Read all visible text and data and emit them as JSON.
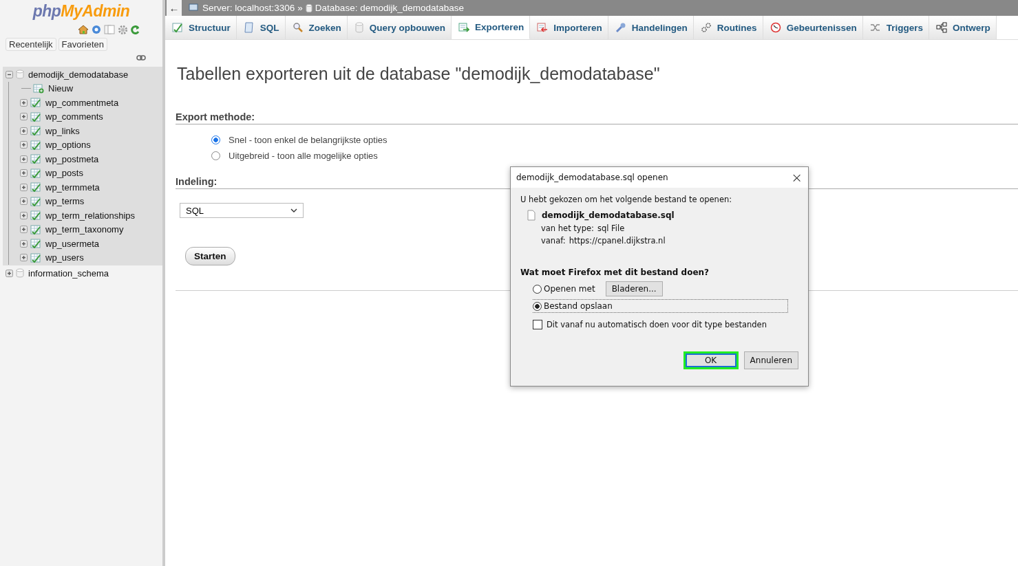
{
  "sidebar": {
    "logo": {
      "part_1": "php",
      "part_2": "MyAdmin"
    },
    "tabs": [
      {
        "label": "Recentelijk"
      },
      {
        "label": "Favorieten"
      }
    ],
    "tree": [
      {
        "label": "demodijk_demodatabase",
        "expanded": true,
        "selected": true,
        "children": [
          {
            "label": "Nieuw",
            "kind": "new"
          },
          {
            "label": "wp_commentmeta",
            "kind": "table",
            "expanded": false
          },
          {
            "label": "wp_comments",
            "kind": "table",
            "expanded": false
          },
          {
            "label": "wp_links",
            "kind": "table",
            "expanded": false
          },
          {
            "label": "wp_options",
            "kind": "table",
            "expanded": false
          },
          {
            "label": "wp_postmeta",
            "kind": "table",
            "expanded": false
          },
          {
            "label": "wp_posts",
            "kind": "table",
            "expanded": false
          },
          {
            "label": "wp_termmeta",
            "kind": "table",
            "expanded": false
          },
          {
            "label": "wp_terms",
            "kind": "table",
            "expanded": false
          },
          {
            "label": "wp_term_relationships",
            "kind": "table",
            "expanded": false
          },
          {
            "label": "wp_term_taxonomy",
            "kind": "table",
            "expanded": false
          },
          {
            "label": "wp_usermeta",
            "kind": "table",
            "expanded": false
          },
          {
            "label": "wp_users",
            "kind": "table",
            "expanded": false
          }
        ]
      },
      {
        "label": "information_schema",
        "expanded": false,
        "selected": false
      }
    ]
  },
  "breadcrumb": {
    "back": "←",
    "server": "Server: localhost:3306",
    "separator": "»",
    "database": "Database: demodijk_demodatabase"
  },
  "tabs": [
    {
      "label": "Structuur",
      "kind": "structure",
      "selected": false
    },
    {
      "label": "SQL",
      "kind": "sql",
      "selected": false
    },
    {
      "label": "Zoeken",
      "kind": "search",
      "selected": false
    },
    {
      "label": "Query opbouwen",
      "kind": "query",
      "selected": false
    },
    {
      "label": "Exporteren",
      "kind": "export",
      "selected": true
    },
    {
      "label": "Importeren",
      "kind": "import",
      "selected": false
    },
    {
      "label": "Handelingen",
      "kind": "wrench",
      "selected": false
    },
    {
      "label": "Routines",
      "kind": "gears",
      "selected": false
    },
    {
      "label": "Gebeurtenissen",
      "kind": "clock",
      "selected": false
    },
    {
      "label": "Triggers",
      "kind": "shuffle",
      "selected": false
    },
    {
      "label": "Ontwerp",
      "kind": "designer",
      "selected": false
    }
  ],
  "page": {
    "title": "Tabellen exporteren uit de database \"demodijk_demodatabase\"",
    "method": {
      "heading": "Export methode:",
      "options": [
        {
          "label": "Snel - toon enkel de belangrijkste opties",
          "selected": true
        },
        {
          "label": "Uitgebreid - toon alle mogelijke opties",
          "selected": false
        }
      ]
    },
    "format": {
      "heading": "Indeling:",
      "value": "SQL"
    },
    "submit": "Starten"
  },
  "dialog": {
    "title": "demodijk_demodatabase.sql openen",
    "close": "×",
    "intro": "U hebt gekozen om het volgende bestand te openen:",
    "filename": "demodijk_demodatabase.sql",
    "type_label": "van het type:",
    "type_value": "sql File",
    "from_label": "vanaf:",
    "from_value": "https://cpanel.dijkstra.nl",
    "question": "Wat moet Firefox met dit bestand doen?",
    "options": [
      {
        "label": "Openen met",
        "selected": false,
        "button": "Bladeren..."
      },
      {
        "label": "Bestand opslaan",
        "selected": true
      }
    ],
    "remember": {
      "label": "Dit vanaf nu automatisch doen voor dit type bestanden",
      "checked": false
    },
    "buttons": [
      {
        "label": "OK",
        "focused": true
      },
      {
        "label": "Annuleren",
        "focused": false
      }
    ]
  }
}
